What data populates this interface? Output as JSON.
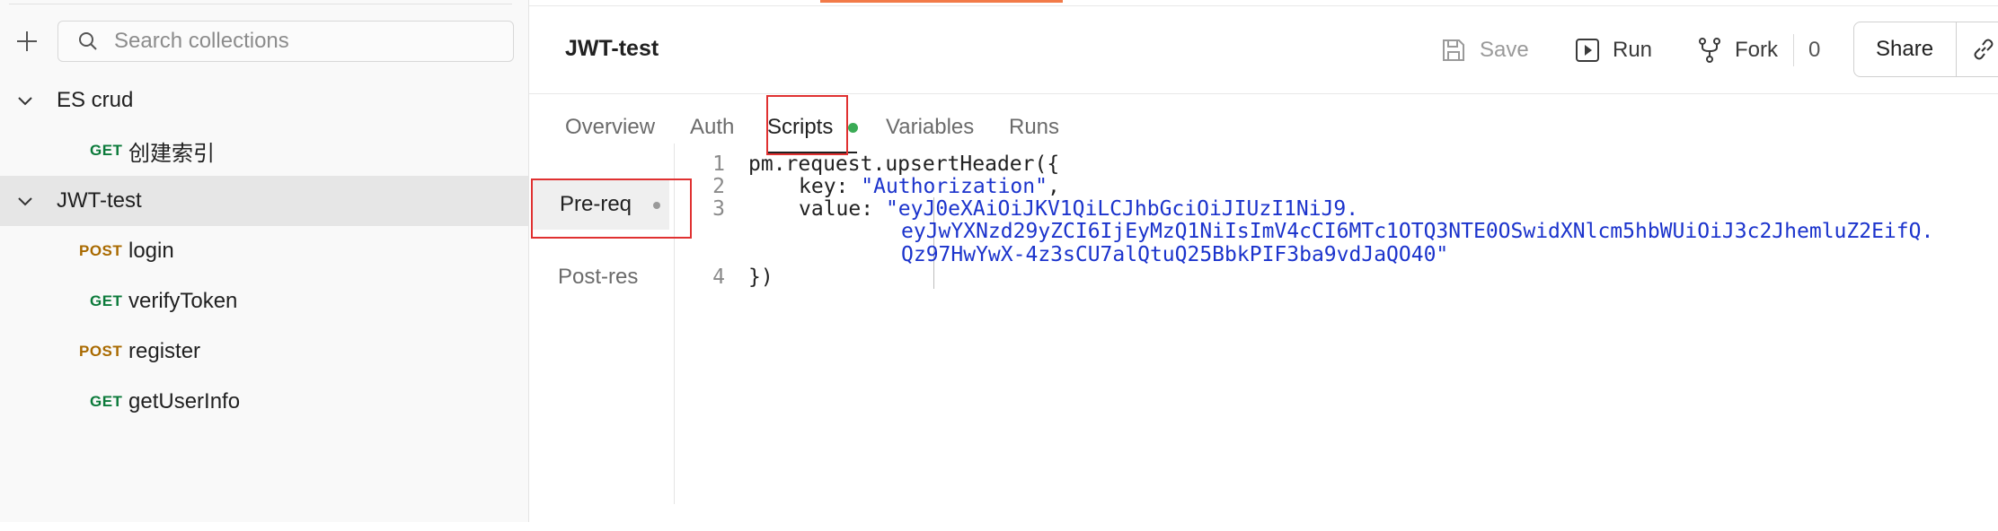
{
  "sidebar": {
    "search_placeholder": "Search collections",
    "collections": [
      {
        "name": "ES crud",
        "requests": [
          {
            "method": "GET",
            "name": "创建索引"
          }
        ]
      },
      {
        "name": "JWT-test",
        "requests": [
          {
            "method": "POST",
            "name": "login"
          },
          {
            "method": "GET",
            "name": "verifyToken"
          },
          {
            "method": "POST",
            "name": "register"
          },
          {
            "method": "GET",
            "name": "getUserInfo"
          }
        ]
      }
    ]
  },
  "header": {
    "title": "JWT-test",
    "save_label": "Save",
    "run_label": "Run",
    "fork_label": "Fork",
    "fork_count": "0",
    "share_label": "Share"
  },
  "tabs": [
    "Overview",
    "Auth",
    "Scripts",
    "Variables",
    "Runs"
  ],
  "active_tab": "Scripts",
  "script_tabs": [
    "Pre-req",
    "Post-res"
  ],
  "active_script_tab": "Pre-req",
  "code": {
    "line_numbers": [
      "1",
      "2",
      "3",
      "4"
    ],
    "line1": "pm.request.upsertHeader({",
    "line2_key": "key: ",
    "line2_value": "\"Authorization\"",
    "line2_tail": ",",
    "line3_key": "value: ",
    "line3_value_a": "\"eyJ0eXAiOiJKV1QiLCJhbGciOiJIUzI1NiJ9.",
    "line3_value_b": "eyJwYXNzd29yZCI6IjEyMzQ1NiIsImV4cCI6MTc1OTQ3NTE0OSwidXNlcm5hbWUiOiJ3c2JhemluZ2EifQ.",
    "line3_value_c": "Qz97HwYwX-4z3sCU7alQtuQ25BbkPIF3ba9vdJaQO40\"",
    "line4": "})"
  },
  "colors": {
    "accent": "#f27a48",
    "get": "#0b7a3a",
    "post": "#a96a00",
    "string": "#1b33cc",
    "highlight_box": "#e03131",
    "scripts_dot": "#3aab55"
  }
}
